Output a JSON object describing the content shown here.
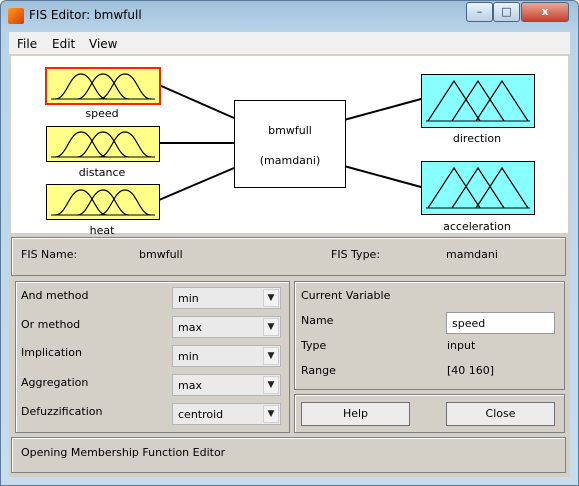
{
  "window": {
    "title": "FIS Editor: bmwfull",
    "minimize": "–",
    "maximize": "□",
    "close": "x"
  },
  "menu": [
    "File",
    "Edit",
    "View"
  ],
  "diagram": {
    "inputs": [
      "speed",
      "distance",
      "heat"
    ],
    "outputs": [
      "direction",
      "acceleration"
    ],
    "system_name": "bmwfull",
    "system_type": "(mamdani)",
    "colors": {
      "input": "#ffff88",
      "output": "#88ffff",
      "selected": "#ff2200"
    }
  },
  "fis": {
    "name_label": "FIS Name:",
    "name": "bmwfull",
    "type_label": "FIS Type:",
    "type": "mamdani"
  },
  "methods": [
    {
      "label": "And method",
      "value": "min"
    },
    {
      "label": "Or method",
      "value": "max"
    },
    {
      "label": "Implication",
      "value": "min"
    },
    {
      "label": "Aggregation",
      "value": "max"
    },
    {
      "label": "Defuzzification",
      "value": "centroid"
    }
  ],
  "current_variable": {
    "heading": "Current Variable",
    "name_label": "Name",
    "name": "speed",
    "type_label": "Type",
    "type": "input",
    "range_label": "Range",
    "range": "[40 160]"
  },
  "buttons": {
    "help": "Help",
    "close": "Close"
  },
  "status": "Opening Membership Function Editor"
}
